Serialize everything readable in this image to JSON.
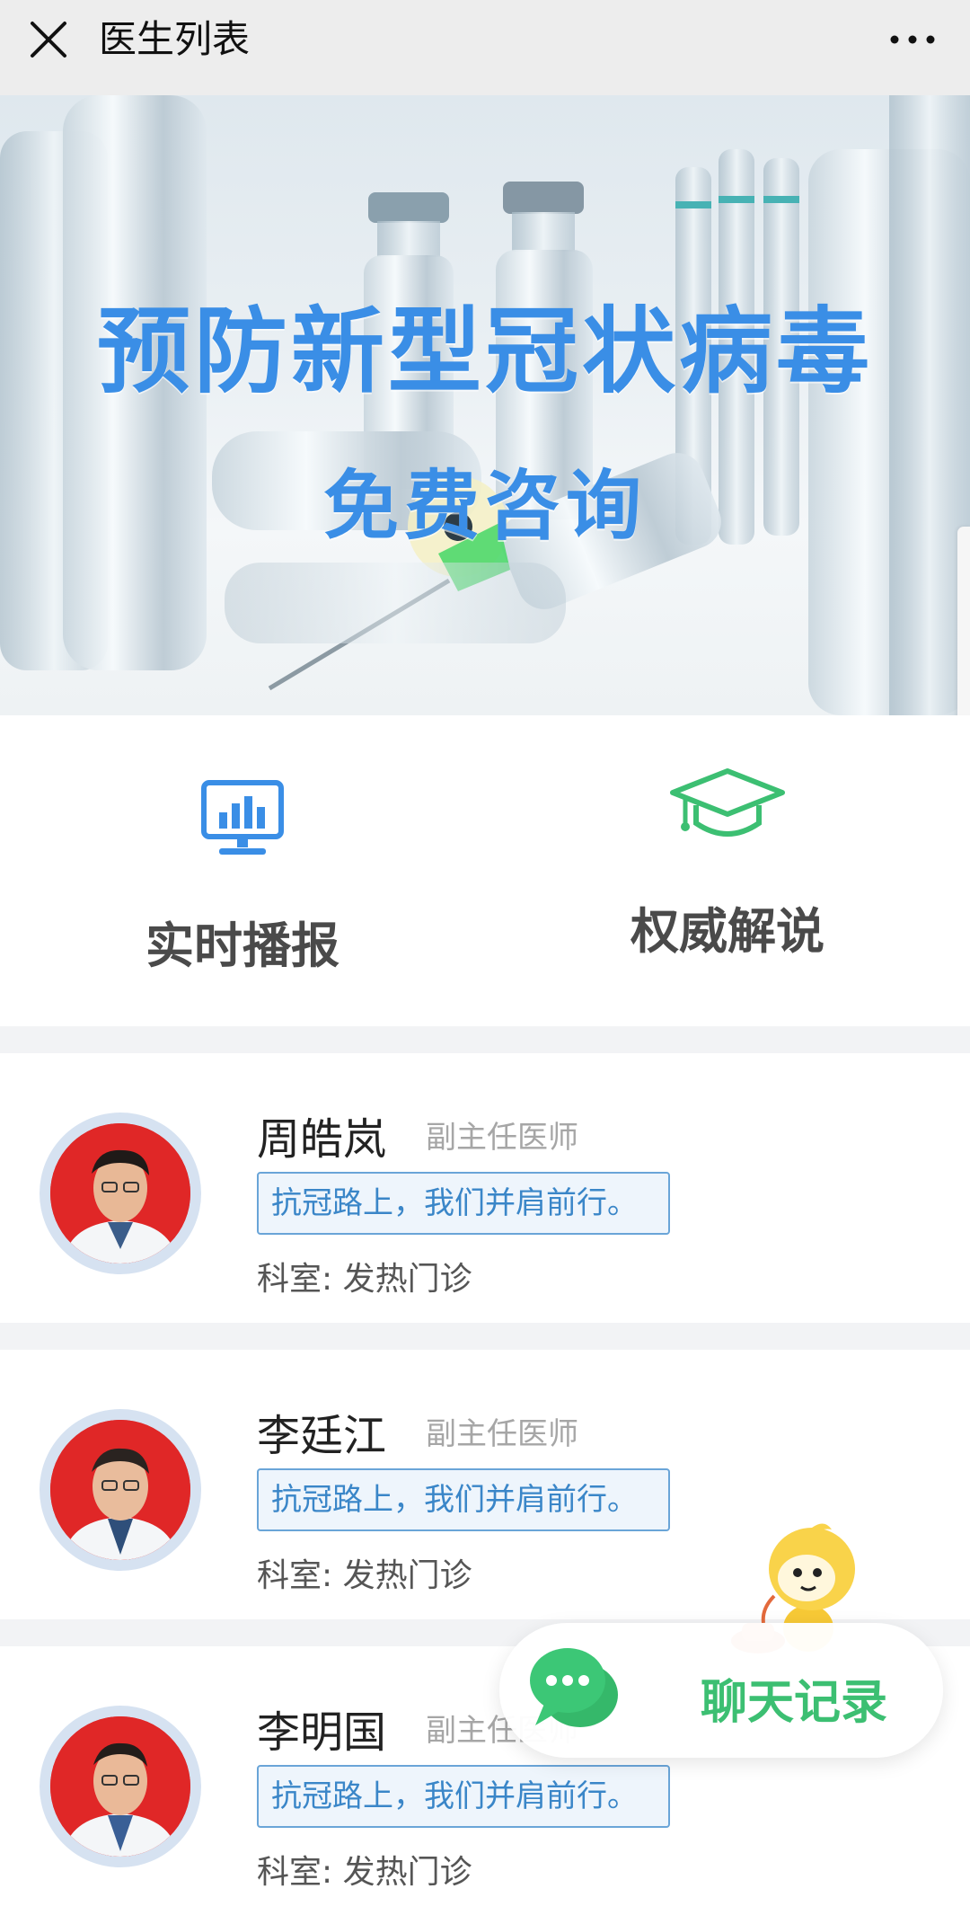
{
  "topbar": {
    "close_icon": "close-icon",
    "title": "医生列表",
    "more_icon": "more-icon"
  },
  "banner": {
    "headline": "预防新型冠状病毒",
    "subtitle": "免费咨询",
    "accent": "#3a8ee6"
  },
  "quick_links": [
    {
      "label": "实时播报",
      "icon": "monitor-chart-icon",
      "color": "#3a8ee6"
    },
    {
      "label": "权威解说",
      "icon": "graduation-cap-icon",
      "color": "#3cbf72"
    }
  ],
  "doctors": [
    {
      "name": "周皓岚",
      "rank": "副主任医师",
      "tag": "抗冠路上，我们并肩前行。",
      "dept": "科室: 发热门诊"
    },
    {
      "name": "李廷江",
      "rank": "副主任医师",
      "tag": "抗冠路上，我们并肩前行。",
      "dept": "科室: 发热门诊"
    },
    {
      "name": "李明国",
      "rank": "副主任医师",
      "tag": "抗冠路上，我们并肩前行。",
      "dept": "科室: 发热门诊"
    }
  ],
  "chat_widget": {
    "label": "聊天记录",
    "icon": "chat-bubble-icon",
    "mascot": "mascot-icon",
    "color": "#3cbf72"
  }
}
